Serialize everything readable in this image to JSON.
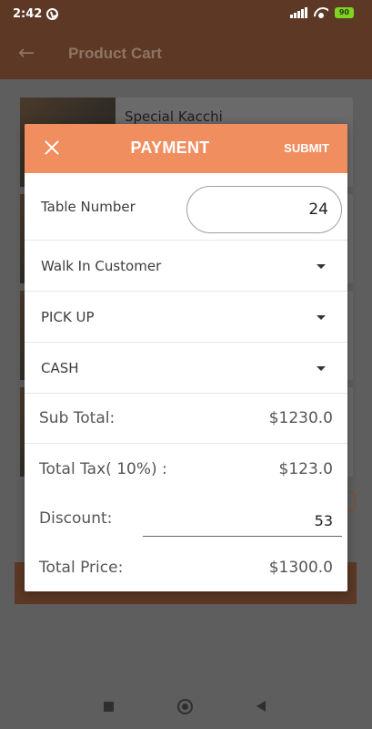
{
  "status_bar": {
    "time": "2:42",
    "battery": "90"
  },
  "app_bar": {
    "title": "Product Cart"
  },
  "background": {
    "first_item_name": "Special Kacchi"
  },
  "dialog": {
    "title": "PAYMENT",
    "submit_label": "SUBMIT",
    "table": {
      "label": "Table Number",
      "value": "24"
    },
    "customer": {
      "selected": "Walk In Customer"
    },
    "order_type": {
      "selected": "PICK UP"
    },
    "payment_method": {
      "selected": "CASH"
    },
    "summary": {
      "subtotal_label": "Sub Total:",
      "subtotal_value": "$1230.0",
      "tax_label": "Total Tax( 10%) :",
      "tax_value": "$123.0",
      "discount_label": "Discount:",
      "discount_value": "53",
      "total_label": "Total Price:",
      "total_value": "$1300.0"
    }
  },
  "colors": {
    "accent": "#f08e5f",
    "app_bar": "#5c3825"
  }
}
